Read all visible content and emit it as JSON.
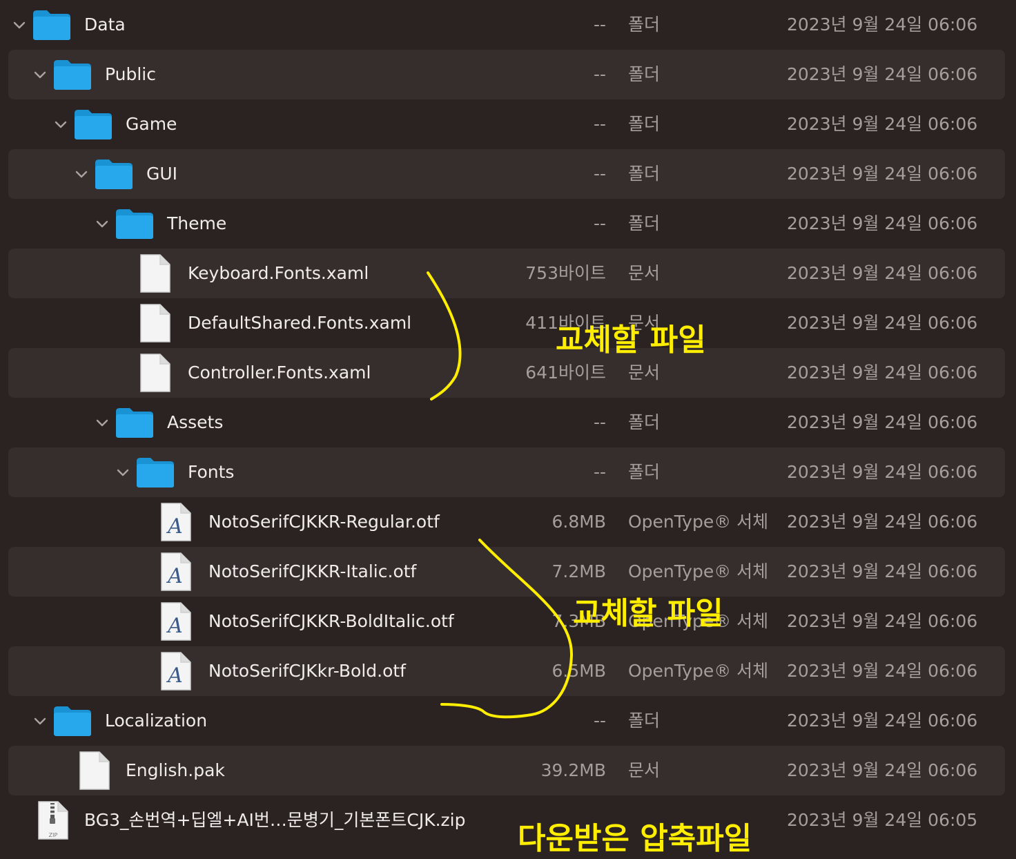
{
  "rows": [
    {
      "name": "Data",
      "size": "--",
      "kind": "폴더",
      "date": "2023년 9월 24일 06:06",
      "icon": "folder-icon",
      "level": 0,
      "expanded": true
    },
    {
      "name": "Public",
      "size": "--",
      "kind": "폴더",
      "date": "2023년 9월 24일 06:06",
      "icon": "folder-icon",
      "level": 1,
      "expanded": true
    },
    {
      "name": "Game",
      "size": "--",
      "kind": "폴더",
      "date": "2023년 9월 24일 06:06",
      "icon": "folder-icon",
      "level": 2,
      "expanded": true
    },
    {
      "name": "GUI",
      "size": "--",
      "kind": "폴더",
      "date": "2023년 9월 24일 06:06",
      "icon": "folder-icon",
      "level": 3,
      "expanded": true
    },
    {
      "name": "Theme",
      "size": "--",
      "kind": "폴더",
      "date": "2023년 9월 24일 06:06",
      "icon": "folder-icon",
      "level": 4,
      "expanded": true
    },
    {
      "name": "Keyboard.Fonts.xaml",
      "size": "753바이트",
      "kind": "문서",
      "date": "2023년 9월 24일 06:06",
      "icon": "document-icon",
      "level": 5
    },
    {
      "name": "DefaultShared.Fonts.xaml",
      "size": "411바이트",
      "kind": "문서",
      "date": "2023년 9월 24일 06:06",
      "icon": "document-icon",
      "level": 5
    },
    {
      "name": "Controller.Fonts.xaml",
      "size": "641바이트",
      "kind": "문서",
      "date": "2023년 9월 24일 06:06",
      "icon": "document-icon",
      "level": 5
    },
    {
      "name": "Assets",
      "size": "--",
      "kind": "폴더",
      "date": "2023년 9월 24일 06:06",
      "icon": "folder-icon",
      "level": 4,
      "expanded": true
    },
    {
      "name": "Fonts",
      "size": "--",
      "kind": "폴더",
      "date": "2023년 9월 24일 06:06",
      "icon": "folder-icon",
      "level": 5,
      "expanded": true
    },
    {
      "name": "NotoSerifCJKKR-Regular.otf",
      "size": "6.8MB",
      "kind": "OpenType® 서체",
      "date": "2023년 9월 24일 06:06",
      "icon": "font-file-icon",
      "level": 6
    },
    {
      "name": "NotoSerifCJKKR-Italic.otf",
      "size": "7.2MB",
      "kind": "OpenType® 서체",
      "date": "2023년 9월 24일 06:06",
      "icon": "font-file-icon",
      "level": 6
    },
    {
      "name": "NotoSerifCJKKR-BoldItalic.otf",
      "size": "7.3MB",
      "kind": "OpenType® 서체",
      "date": "2023년 9월 24일 06:06",
      "icon": "font-file-icon",
      "level": 6
    },
    {
      "name": "NotoSerifCJKkr-Bold.otf",
      "size": "6.5MB",
      "kind": "OpenType® 서체",
      "date": "2023년 9월 24일 06:06",
      "icon": "font-file-icon",
      "level": 6
    },
    {
      "name": "Localization",
      "size": "--",
      "kind": "폴더",
      "date": "2023년 9월 24일 06:06",
      "icon": "folder-icon",
      "level": 1,
      "expanded": true
    },
    {
      "name": "English.pak",
      "size": "39.2MB",
      "kind": "문서",
      "date": "2023년 9월 24일 06:06",
      "icon": "document-icon",
      "level": 2
    },
    {
      "name": "BG3_손번역+딥엘+AI번…문병기_기본폰트CJK.zip",
      "size": "",
      "kind": "",
      "date": "2023년 9월 24일 06:05",
      "icon": "zip-file-icon",
      "level": 0
    }
  ],
  "annotations": {
    "replace_files_1": "교체할 파일",
    "replace_files_2": "교체할 파일",
    "downloaded_zip": "다운받은 압축파일"
  },
  "icon_labels": {
    "zip": "ZIP"
  },
  "colors": {
    "background": "#2a2322",
    "alt_row": "#352e2d",
    "folder_blue": "#1ea3e6",
    "annotation_yellow": "#ffee00"
  }
}
